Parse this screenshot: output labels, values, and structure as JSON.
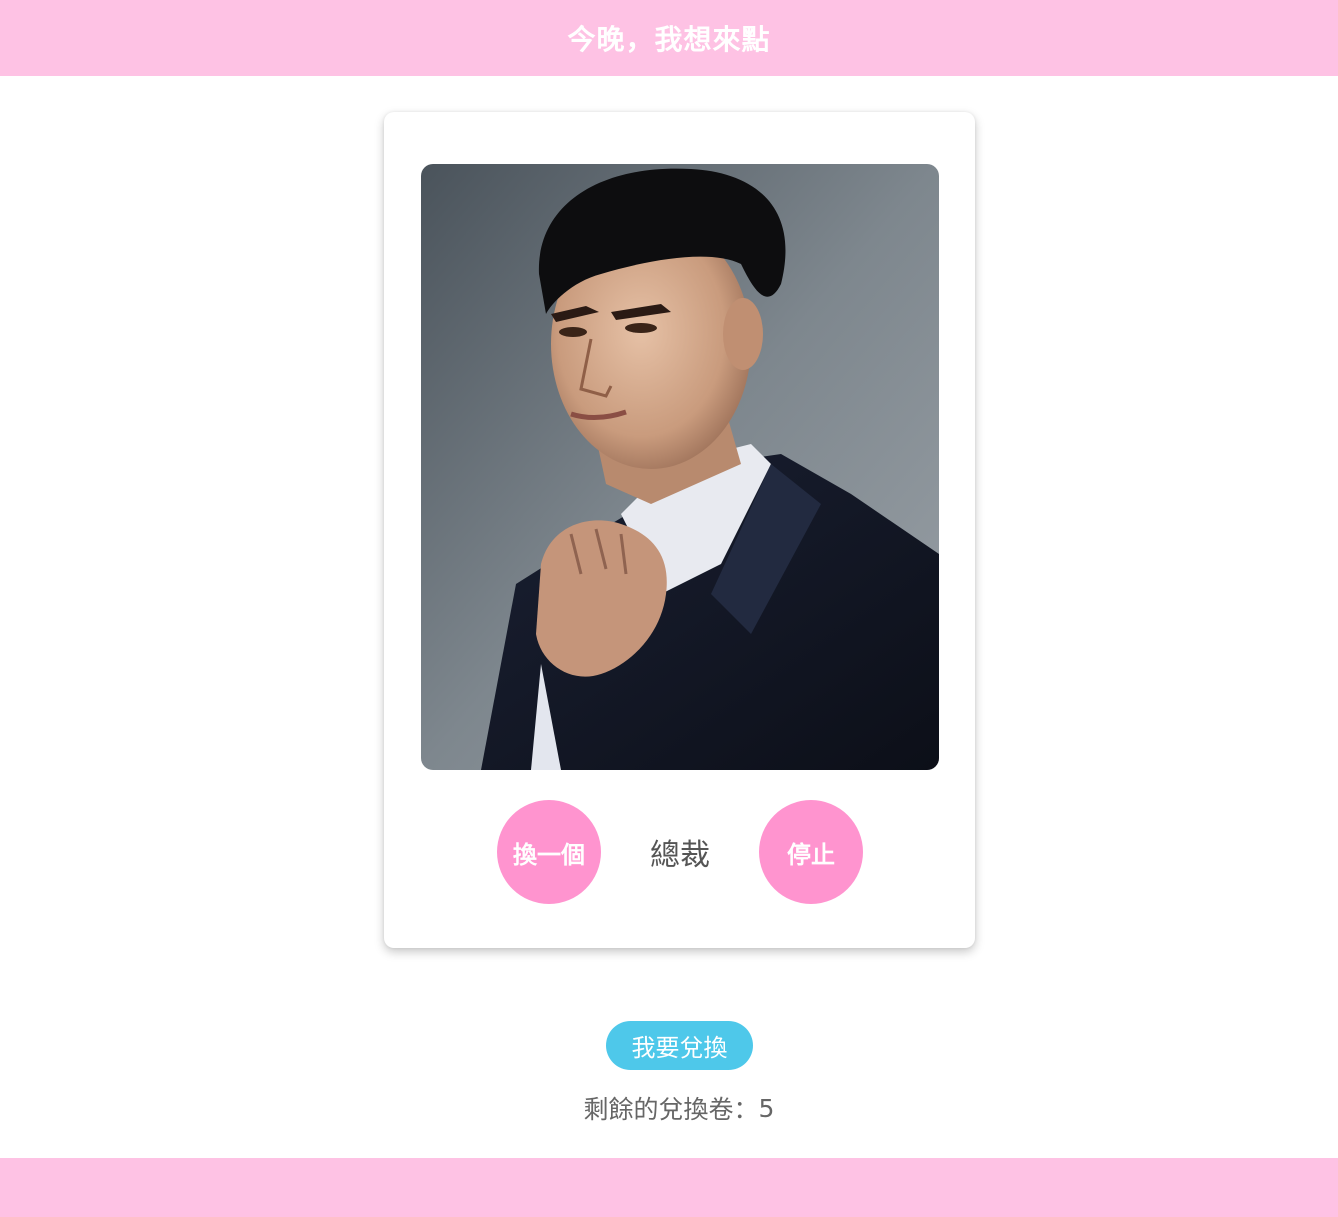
{
  "header": {
    "title": "今晚，我想來點",
    "background": "#fec2e4"
  },
  "card": {
    "photo_alt": "portrait",
    "current_name": "總裁",
    "swap_button_label": "換一個",
    "stop_button_label": "停止",
    "button_color": "#ff94cf"
  },
  "redeem": {
    "button_label": "我要兌換",
    "button_color": "#4ec8ea",
    "remaining_label": "剩餘的兌換卷：",
    "remaining_count": "5"
  },
  "footer": {
    "background": "#fec2e4"
  }
}
